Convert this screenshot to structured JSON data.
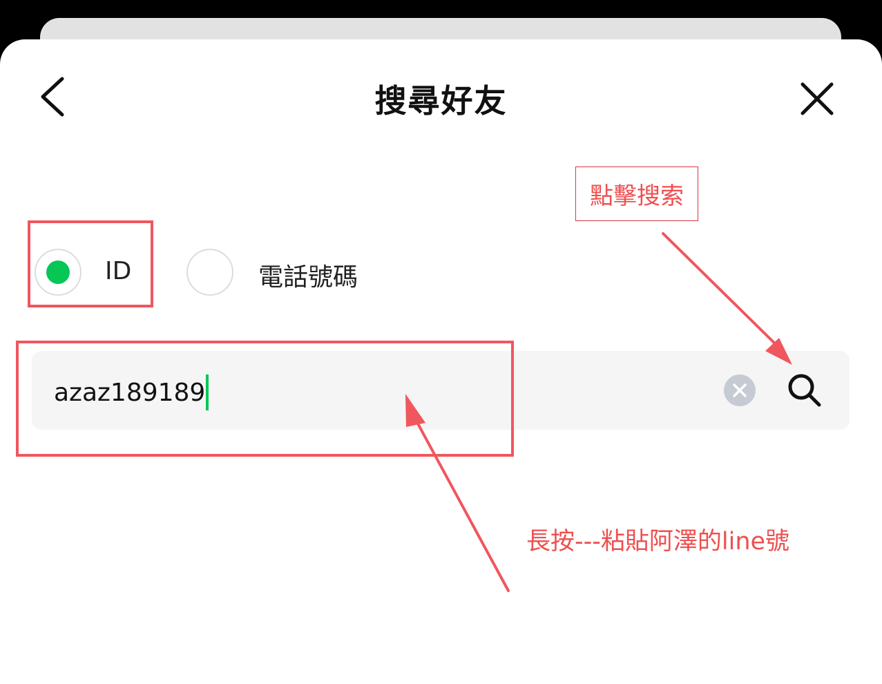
{
  "header": {
    "title": "搜尋好友",
    "back_icon": "chevron-left-icon",
    "close_icon": "close-icon"
  },
  "search_type": {
    "options": [
      {
        "label": "ID",
        "selected": true
      },
      {
        "label": "電話號碼",
        "selected": false
      }
    ]
  },
  "search": {
    "value": "azaz189189",
    "clear_icon": "clear-icon",
    "search_icon": "search-icon"
  },
  "annotations": {
    "tap_search_note": "點擊搜索",
    "paste_note": "長按---粘貼阿澤的line號"
  },
  "colors": {
    "accent": "#06c755",
    "annotation": "#f0565e",
    "annotation_text": "#ef4f4f",
    "field_bg": "#f5f5f5",
    "clear_bg": "#c6cbd3"
  }
}
